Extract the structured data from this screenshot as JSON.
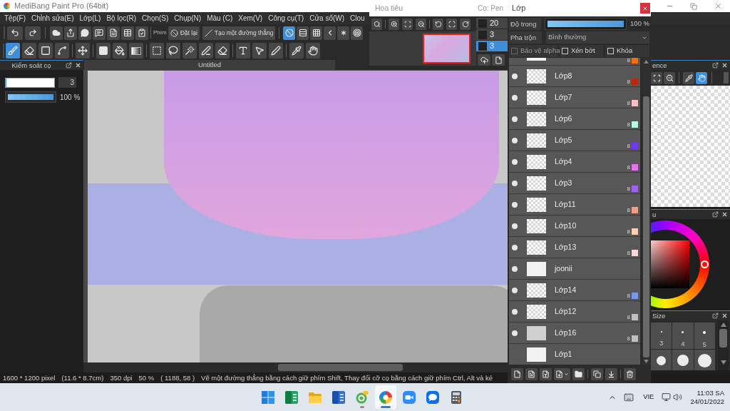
{
  "window": {
    "title": "MediBang Paint Pro (64bit)"
  },
  "menu": [
    "Tệp(F)",
    "Chỉnh sửa(E)",
    "Lớp(L)",
    "Bộ lọc(R)",
    "Chọn(S)",
    "Chụp(N)",
    "Màu (C)",
    "Xem(V)",
    "Công cụ(T)",
    "Cửa sổ(W)",
    "Clou"
  ],
  "toolbar": {
    "shortcut_label": "Phím",
    "buttons": [
      {
        "kind": "reset",
        "label": "Đặt lại"
      },
      {
        "kind": "line",
        "label": "Tạo một đường thẳng"
      }
    ],
    "snaps": [
      {
        "kind": "off",
        "selected": true
      },
      {
        "kind": "parallel",
        "selected": false
      },
      {
        "kind": "grid",
        "selected": false
      },
      {
        "kind": "perspective",
        "selected": false
      },
      {
        "kind": "radial",
        "selected": false
      },
      {
        "kind": "circle",
        "selected": false
      }
    ]
  },
  "tools": [
    [
      {
        "kind": "brush",
        "selected": true
      },
      {
        "kind": "eraser",
        "selected": false
      },
      {
        "kind": "shape",
        "selected": false
      },
      {
        "kind": "polyline",
        "selected": false
      }
    ],
    [
      {
        "kind": "move",
        "selected": false
      }
    ],
    [
      {
        "kind": "fill",
        "selected": false
      },
      {
        "kind": "bucket",
        "selected": false
      },
      {
        "kind": "gradient",
        "selected": false
      }
    ],
    [
      {
        "kind": "select",
        "selected": false
      },
      {
        "kind": "lasso",
        "selected": false
      },
      {
        "kind": "wand",
        "selected": false
      },
      {
        "kind": "selectpen",
        "selected": false
      },
      {
        "kind": "selecteraser",
        "selected": false
      }
    ],
    [
      {
        "kind": "text",
        "selected": false
      },
      {
        "kind": "operation",
        "selected": false
      },
      {
        "kind": "pen",
        "selected": false
      }
    ],
    [
      {
        "kind": "dropper",
        "selected": false
      },
      {
        "kind": "hand",
        "selected": false
      }
    ]
  ],
  "brush_control": {
    "title": "Kiểm soát cọ",
    "size": {
      "level": 0.02,
      "value": "3"
    },
    "opacity": {
      "level": 1,
      "reading": "100 %"
    }
  },
  "canvas": {
    "tab": "Untitled"
  },
  "reference": {
    "title": "ence",
    "tools": [
      {
        "kind": "fit",
        "selected": false
      },
      {
        "kind": "zoomout",
        "selected": false
      },
      {
        "kind": "dropper",
        "selected": false
      },
      {
        "kind": "hand",
        "selected": true
      }
    ]
  },
  "color_panel": {
    "title": "u"
  },
  "size_panel": {
    "title": "Size",
    "items": [
      {
        "kind": "small",
        "label": "3"
      },
      {
        "kind": "small",
        "label": "4"
      },
      {
        "kind": "small",
        "label": "5"
      },
      {
        "kind": "large"
      },
      {
        "kind": "large"
      },
      {
        "kind": "large"
      }
    ]
  },
  "status_bar": [
    "1600 * 1200 pixel",
    "(11.6 * 8.7cm)",
    "350 dpi",
    "50 %",
    "( 1188, 58 )",
    "Vẽ một đường thẳng bằng cách giữ phím Shift, Thay đổi cỡ cọ bằng cách giữ phím Ctrl, Alt và ké"
  ],
  "taskbar": {
    "apps": [
      {
        "kind": "start",
        "running": false,
        "selected": false
      },
      {
        "kind": "spreadsheet",
        "running": false,
        "selected": false
      },
      {
        "kind": "folder",
        "running": false,
        "selected": false
      },
      {
        "kind": "document",
        "running": false,
        "selected": false
      },
      {
        "kind": "circle",
        "running": true,
        "selected": false
      },
      {
        "kind": "pinwheel",
        "running": true,
        "selected": true
      },
      {
        "kind": "video",
        "running": false,
        "selected": false
      },
      {
        "kind": "chat",
        "running": false,
        "selected": false
      },
      {
        "kind": "calculator",
        "running": false,
        "selected": false
      }
    ],
    "language": "VIE",
    "time": "11:03 SA",
    "date": "24/01/2022"
  },
  "navigator": {
    "title": "Hoa tiêu"
  },
  "brush_panel": {
    "title": "Cọ: Pen",
    "items": [
      {
        "size": "20",
        "selected": false
      },
      {
        "size": "3",
        "selected": false
      },
      {
        "size": "3",
        "selected": true
      }
    ]
  },
  "layers": {
    "title": "Lớp",
    "opacity": {
      "label": "Độ trong",
      "level": 1,
      "reading": "100 %"
    },
    "blend": {
      "label": "Pha trộn",
      "value": "Bình thường"
    },
    "options": [
      {
        "label": "Bảo vệ alpha",
        "checked": false,
        "disabled": true
      },
      {
        "label": "Xén bớt",
        "checked": false,
        "disabled": false
      },
      {
        "label": "Khóa",
        "checked": false,
        "disabled": false
      }
    ],
    "items": [
      {
        "kind": "cut",
        "thumbnail": {
          "kind": "white"
        },
        "badge": "8",
        "color": "#f07010"
      },
      {
        "kind": "layer",
        "name": "Lớp8",
        "visible": true,
        "thumbnail": {
          "kind": "checker"
        },
        "badge": "8",
        "color": "#c0280c"
      },
      {
        "kind": "layer",
        "name": "Lớp7",
        "visible": true,
        "thumbnail": {
          "kind": "checker"
        },
        "badge": "8",
        "color": "#f8c0c0"
      },
      {
        "kind": "layer",
        "name": "Lớp6",
        "visible": true,
        "thumbnail": {
          "kind": "checker"
        },
        "badge": "8",
        "color": "#b8f8e8"
      },
      {
        "kind": "layer",
        "name": "Lớp5",
        "visible": true,
        "thumbnail": {
          "kind": "checker"
        },
        "badge": "8",
        "color": "#7038f0"
      },
      {
        "kind": "layer",
        "name": "Lớp4",
        "visible": true,
        "thumbnail": {
          "kind": "checker"
        },
        "badge": "8",
        "color": "#e870f0"
      },
      {
        "kind": "layer",
        "name": "Lớp3",
        "visible": true,
        "thumbnail": {
          "kind": "checker"
        },
        "badge": "8",
        "color": "#a060f0"
      },
      {
        "kind": "layer",
        "name": "Lớp11",
        "visible": true,
        "thumbnail": {
          "kind": "checker"
        },
        "badge": "8",
        "color": "#f0a088"
      },
      {
        "kind": "layer",
        "name": "Lớp10",
        "visible": true,
        "thumbnail": {
          "kind": "checker"
        },
        "badge": "8",
        "color": "#f8d0b8"
      },
      {
        "kind": "layer",
        "name": "Lớp13",
        "visible": true,
        "thumbnail": {
          "kind": "checker"
        },
        "badge": "8",
        "color": "#f8d8d8"
      },
      {
        "kind": "layer",
        "name": "joonii",
        "visible": true,
        "thumbnail": {
          "kind": "white"
        }
      },
      {
        "kind": "layer",
        "name": "Lớp14",
        "visible": true,
        "thumbnail": {
          "kind": "checker"
        },
        "badge": "8",
        "color": "#7898f0"
      },
      {
        "kind": "layer",
        "name": "Lớp12",
        "visible": true,
        "thumbnail": {
          "kind": "checker"
        },
        "badge": "8",
        "color": "#c0c0c0"
      },
      {
        "kind": "layer",
        "name": "Lớp16",
        "visible": true,
        "thumbnail": {
          "kind": "gray"
        },
        "badge": "8",
        "color": "#c0c0c0"
      },
      {
        "kind": "layer",
        "name": "Lớp1",
        "visible": false,
        "thumbnail": {
          "kind": "white"
        }
      }
    ]
  }
}
